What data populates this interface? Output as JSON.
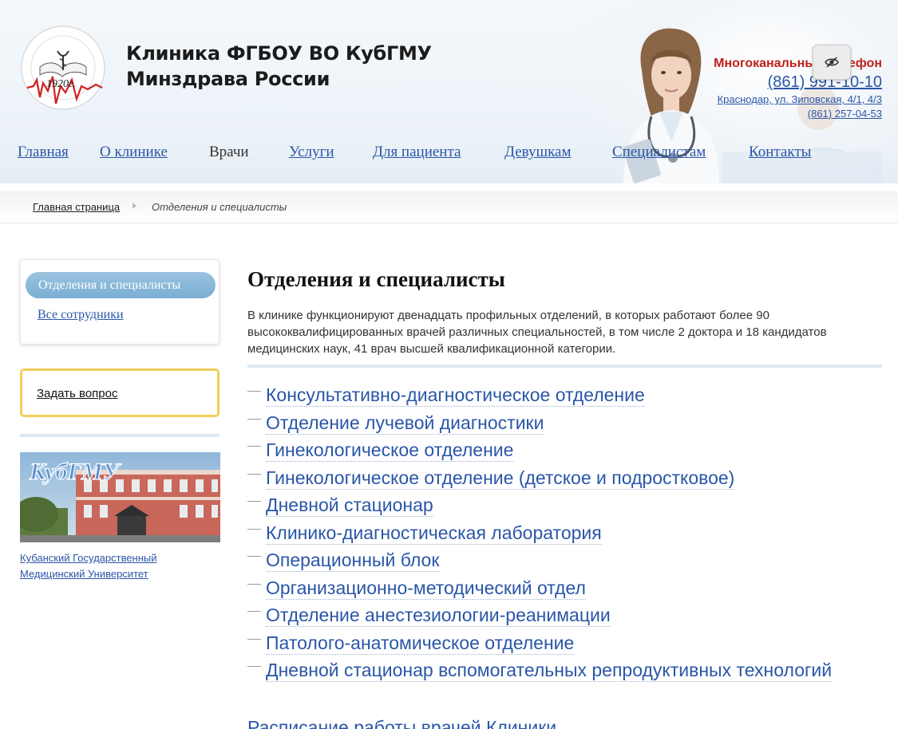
{
  "header": {
    "site_title_line1": "Клиника ФГБОУ ВО КубГМУ",
    "site_title_line2": "Минздрава России",
    "logo_year": "1920г.",
    "logo_ring_text": "Кубанский Государственный Медицинский Университет",
    "phone_label": "Многоканальный телефон",
    "phone_main": "(861) 991-10-10",
    "address": "Краснодар, ул. Зиповская, 4/1, 4/3",
    "phone_alt": "(861) 257-04-53"
  },
  "nav": {
    "items": [
      {
        "label": "Главная"
      },
      {
        "label": "О клинике"
      },
      {
        "label": "Врачи"
      },
      {
        "label": "Услуги"
      },
      {
        "label": "Для пациента"
      },
      {
        "label": "Девушкам"
      },
      {
        "label": "Специалистам"
      },
      {
        "label": "Контакты"
      }
    ],
    "current_index": 2
  },
  "breadcrumb": {
    "home": "Главная страница",
    "current": "Отделения и специалисты"
  },
  "sidebar": {
    "menu_active": "Отделения и специалисты",
    "menu_link": "Все сотрудники",
    "ask_question": "Задать вопрос",
    "banner_text": "КубГМУ",
    "banner_caption_line1": "Кубанский Государственный",
    "banner_caption_line2": "Медицинский Университет"
  },
  "main": {
    "title": "Отделения и специалисты",
    "intro": "В клинике функционируют двенадцать профильных отделений, в которых работают более 90 высококвалифицированных врачей различных специальностей, в том числе 2 доктора и 18 кандидатов медицинских наук, 41 врач высшей квалификационной категории.",
    "departments": [
      "Консультативно-диагностическое отделение",
      "Отделение лучевой диагностики",
      "Гинекологическое отделение",
      "Гинекологическое отделение (детское и подростковое)",
      "Дневной стационар",
      "Клинико-диагностическая лаборатория",
      "Операционный блок",
      "Организационно-методический отдел",
      "Отделение анестезиологии-реанимации",
      "Патолого-анатомическое отделение",
      "Дневной стационар вспомогательных репродуктивных технологий"
    ],
    "schedule_link": "Расписание работы врачей Клиники"
  },
  "colors": {
    "link": "#2a56a8",
    "phone_label": "#c0201c",
    "active_pill": "#7aaed3",
    "ask_border": "#f0cf5a",
    "divider": "#dde9f1"
  },
  "icons": {
    "accessibility_toggle": "eye-slash-icon",
    "breadcrumb_separator": "triangle-right-icon"
  }
}
